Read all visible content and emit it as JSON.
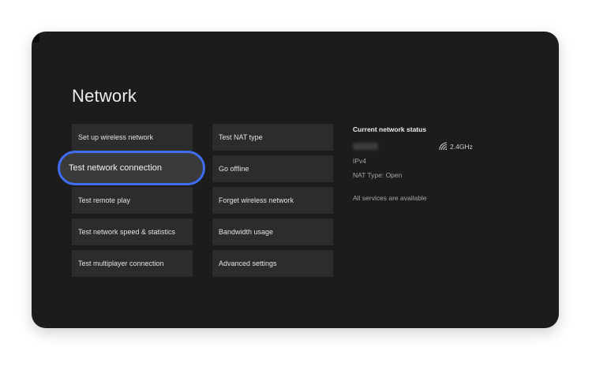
{
  "page": {
    "title": "Network"
  },
  "menu": {
    "column1": [
      {
        "label": "Set up wireless network"
      },
      {
        "label": "Test network connection",
        "focused": true
      },
      {
        "label": "Test remote play"
      },
      {
        "label": "Test network speed & statistics"
      },
      {
        "label": "Test multiplayer connection"
      }
    ],
    "column2": [
      {
        "label": "Test NAT type"
      },
      {
        "label": "Go offline"
      },
      {
        "label": "Forget wireless network"
      },
      {
        "label": "Bandwidth usage"
      },
      {
        "label": "Advanced settings"
      }
    ]
  },
  "status": {
    "heading": "Current network status",
    "band": "2.4GHz",
    "band_icon": "wifi-signal-icon",
    "protocol": "IPv4",
    "nat": "NAT Type: Open",
    "services": "All services are available"
  },
  "colors": {
    "background": "#1c1c1c",
    "tile": "#2c2c2c",
    "focus_ring": "#3f6ef2"
  }
}
